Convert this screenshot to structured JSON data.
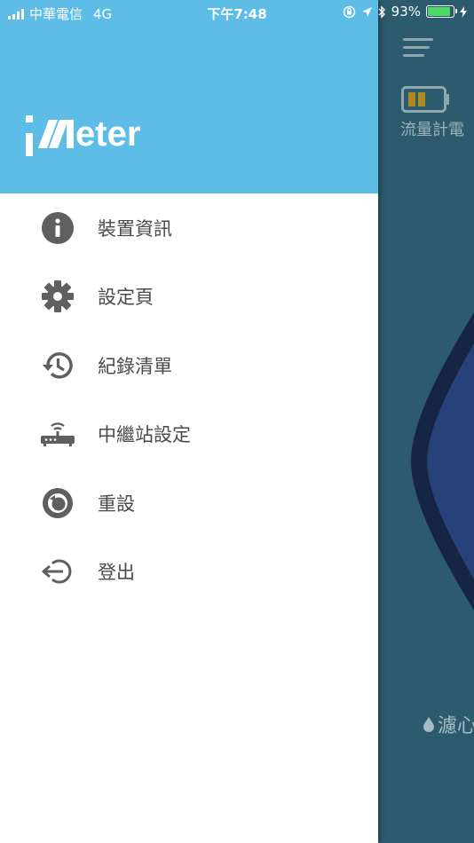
{
  "status_bar": {
    "carrier": "中華電信",
    "network": "4G",
    "time": "下午7:48",
    "battery_percent": "93%",
    "battery_level": 0.93,
    "battery_color": "#4cd964"
  },
  "drawer": {
    "header_color": "#5ebde7",
    "logo_text": "eter",
    "menu_items": [
      {
        "id": "device-info",
        "icon": "info-icon",
        "label": "裝置資訊"
      },
      {
        "id": "settings",
        "icon": "gear-icon",
        "label": "設定頁"
      },
      {
        "id": "history",
        "icon": "history-icon",
        "label": "紀錄清單"
      },
      {
        "id": "repeater",
        "icon": "router-icon",
        "label": "中繼站設定"
      },
      {
        "id": "reset",
        "icon": "reset-icon",
        "label": "重設"
      },
      {
        "id": "logout",
        "icon": "logout-icon",
        "label": "登出"
      }
    ]
  },
  "background_app": {
    "flow_meter_label": "流量計電",
    "filter_label": "濾心"
  }
}
